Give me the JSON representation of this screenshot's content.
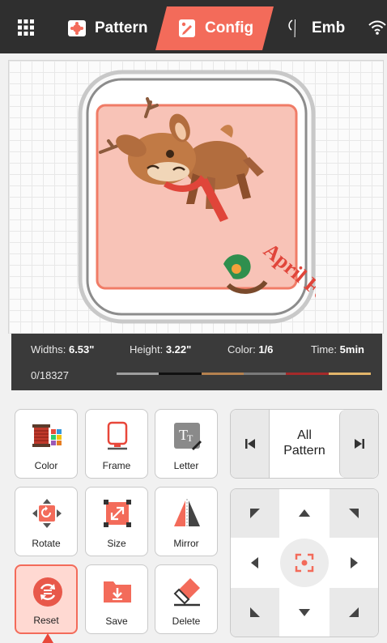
{
  "top_bar": {
    "tabs": [
      {
        "label": "Pattern",
        "icon": "pattern-icon"
      },
      {
        "label": "Config",
        "icon": "config-icon",
        "active": true
      },
      {
        "label": "Emb",
        "icon": "needle-icon"
      }
    ],
    "accent_color": "#f36b5a"
  },
  "design": {
    "text_art": "April Fools Day"
  },
  "info": {
    "width_label": "Widths:",
    "width_value": "6.53\"",
    "height_label": "Height:",
    "height_value": "3.22\"",
    "color_label": "Color:",
    "color_value": "1/6",
    "time_label": "Time:",
    "time_value": "5min",
    "stitch_count": "0/18327",
    "thread_colors": [
      "#9e9e9e",
      "#111111",
      "#b5814f",
      "#7a7a7a",
      "#a52a2a",
      "#e2b56a"
    ]
  },
  "tools": [
    {
      "label": "Color",
      "icon": "thread-spool-icon"
    },
    {
      "label": "Frame",
      "icon": "frame-icon"
    },
    {
      "label": "Letter",
      "icon": "letter-icon"
    },
    {
      "label": "Rotate",
      "icon": "rotate-icon"
    },
    {
      "label": "Size",
      "icon": "resize-icon"
    },
    {
      "label": "Mirror",
      "icon": "mirror-icon"
    },
    {
      "label": "Reset",
      "icon": "reset-icon",
      "active": true
    },
    {
      "label": "Save",
      "icon": "save-icon"
    },
    {
      "label": "Delete",
      "icon": "eraser-icon"
    }
  ],
  "pattern_nav": {
    "line1": "All",
    "line2": "Pattern"
  }
}
